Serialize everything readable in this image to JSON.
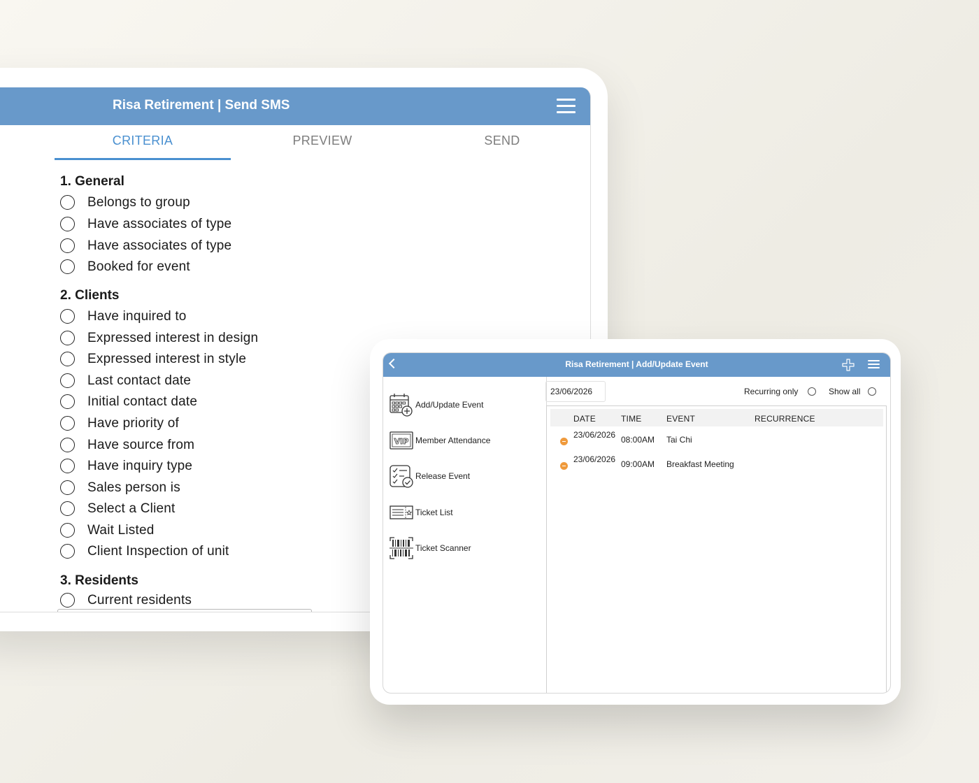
{
  "sms_app": {
    "title": "Risa Retirement | Send SMS",
    "tabs": [
      {
        "label": "CRITERIA",
        "active": true
      },
      {
        "label": "PREVIEW",
        "active": false
      },
      {
        "label": "SEND",
        "active": false
      }
    ],
    "sections": [
      {
        "title": "1.  General",
        "options": [
          "Belongs to group",
          "Have associates of type",
          "Have associates of type",
          "Booked for event"
        ]
      },
      {
        "title": "2. Clients",
        "options": [
          "Have inquired to",
          "Expressed interest in design",
          "Expressed interest in style",
          "Last contact date",
          "Initial contact date",
          "Have priority of",
          "Have source from",
          "Have inquiry type",
          "Sales person is",
          "Select a Client",
          "Wait Listed",
          "Client Inspection of unit"
        ]
      },
      {
        "title": "3. Residents",
        "options": [
          "Current residents"
        ]
      }
    ]
  },
  "event_app": {
    "title": "Risa Retirement | Add/Update Event",
    "sidebar": [
      {
        "label": "Add/Update Event",
        "icon": "calendar-add-icon"
      },
      {
        "label": "Member Attendance",
        "icon": "vip-ticket-icon"
      },
      {
        "label": "Release Event",
        "icon": "checklist-icon"
      },
      {
        "label": "Ticket List",
        "icon": "ticket-list-icon"
      },
      {
        "label": "Ticket Scanner",
        "icon": "barcode-scanner-icon"
      }
    ],
    "date_value": "23/06/2026",
    "filters": {
      "recurring_only": "Recurring only",
      "show_all": "Show all"
    },
    "table": {
      "headers": [
        "DATE",
        "TIME",
        "EVENT",
        "RECURRENCE"
      ],
      "rows": [
        {
          "date": "23/06/2026",
          "time": "08:00AM",
          "event": "Tai Chi",
          "recurrence": ""
        },
        {
          "date": "23/06/2026",
          "time": "09:00AM",
          "event": "Breakfast Meeting",
          "recurrence": ""
        }
      ]
    },
    "colors": {
      "header": "#6899ca",
      "status_dot": "#ef9a3c",
      "active_tab": "#4a90d0"
    }
  }
}
